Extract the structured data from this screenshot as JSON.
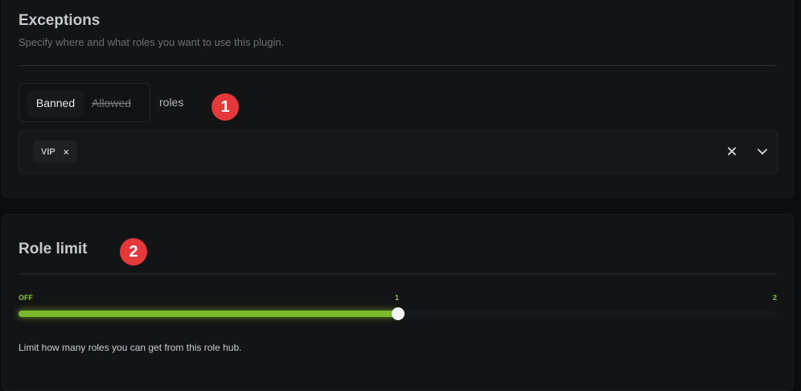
{
  "exceptions": {
    "title": "Exceptions",
    "subtitle": "Specify where and what roles you want to use this plugin.",
    "mode": {
      "banned_label": "Banned",
      "allowed_label": "Allowed",
      "selected": "Banned"
    },
    "roles_label": "roles",
    "selected_roles": [
      "VIP"
    ],
    "chip_remove": "×",
    "badge": "1"
  },
  "role_limit": {
    "title": "Role limit",
    "badge": "2",
    "slider": {
      "min_label": "OFF",
      "current_label": "1",
      "max_label": "2",
      "min": 0,
      "max": 2,
      "value": 1
    },
    "help": "Limit how many roles you can get from this role hub."
  },
  "colors": {
    "accent": "#7ab929",
    "badge": "#e5383b",
    "background": "#0c0d0f",
    "card": "#131416"
  }
}
